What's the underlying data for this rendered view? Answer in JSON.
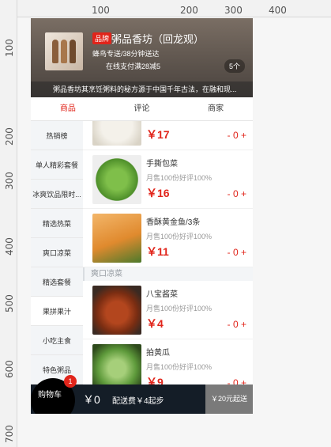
{
  "ruler": {
    "top_ticks": [
      "100",
      "200",
      "300",
      "400"
    ],
    "left_ticks": [
      "100",
      "200",
      "300",
      "400",
      "500",
      "600",
      "700"
    ]
  },
  "header": {
    "brand_badge": "品牌",
    "shop_name": "粥品香坊（回龙观）",
    "delivery_info": "蜂鸟专送/38分钟送达",
    "promo": "在线支付满28减5",
    "promo_count": "5个",
    "notice": "粥品香坊其烹饪粥料的秘方源于中国千年古法，在融和现..."
  },
  "tabs": [
    {
      "label": "商品"
    },
    {
      "label": "评论"
    },
    {
      "label": "商家"
    }
  ],
  "menu": {
    "items": [
      {
        "label": "热销榜"
      },
      {
        "label": "单人精彩套餐"
      },
      {
        "label": "冰爽饮品限时..."
      },
      {
        "label": "精选热菜"
      },
      {
        "label": "爽口凉菜"
      },
      {
        "label": "精选套餐"
      },
      {
        "label": "果拼果汁"
      },
      {
        "label": "小吃主食"
      },
      {
        "label": "特色粥品"
      }
    ]
  },
  "goods": {
    "foods": [
      {
        "name": "",
        "sales": "",
        "price": "￥17",
        "ctrl": "- 0 +"
      },
      {
        "name": "手撕包菜",
        "sales": "月售100份好评100%",
        "price": "￥16",
        "ctrl": "- 0 +"
      },
      {
        "name": "香酥黄金鱼/3条",
        "sales": "月售100份好评100%",
        "price": "￥11",
        "ctrl": "- 0 +"
      },
      {
        "name": "八宝酱菜",
        "sales": "月售100份好评100%",
        "price": "￥4",
        "ctrl": "- 0 +"
      },
      {
        "name": "拍黄瓜",
        "sales": "月售100份好评100%",
        "price": "￥9",
        "ctrl": "- 0 +"
      }
    ],
    "section_title": "爽口凉菜"
  },
  "cart": {
    "label": "购物车",
    "badge": "1",
    "total": "￥0",
    "fee": "配送费￥4起步",
    "min": "￥20元起送"
  }
}
